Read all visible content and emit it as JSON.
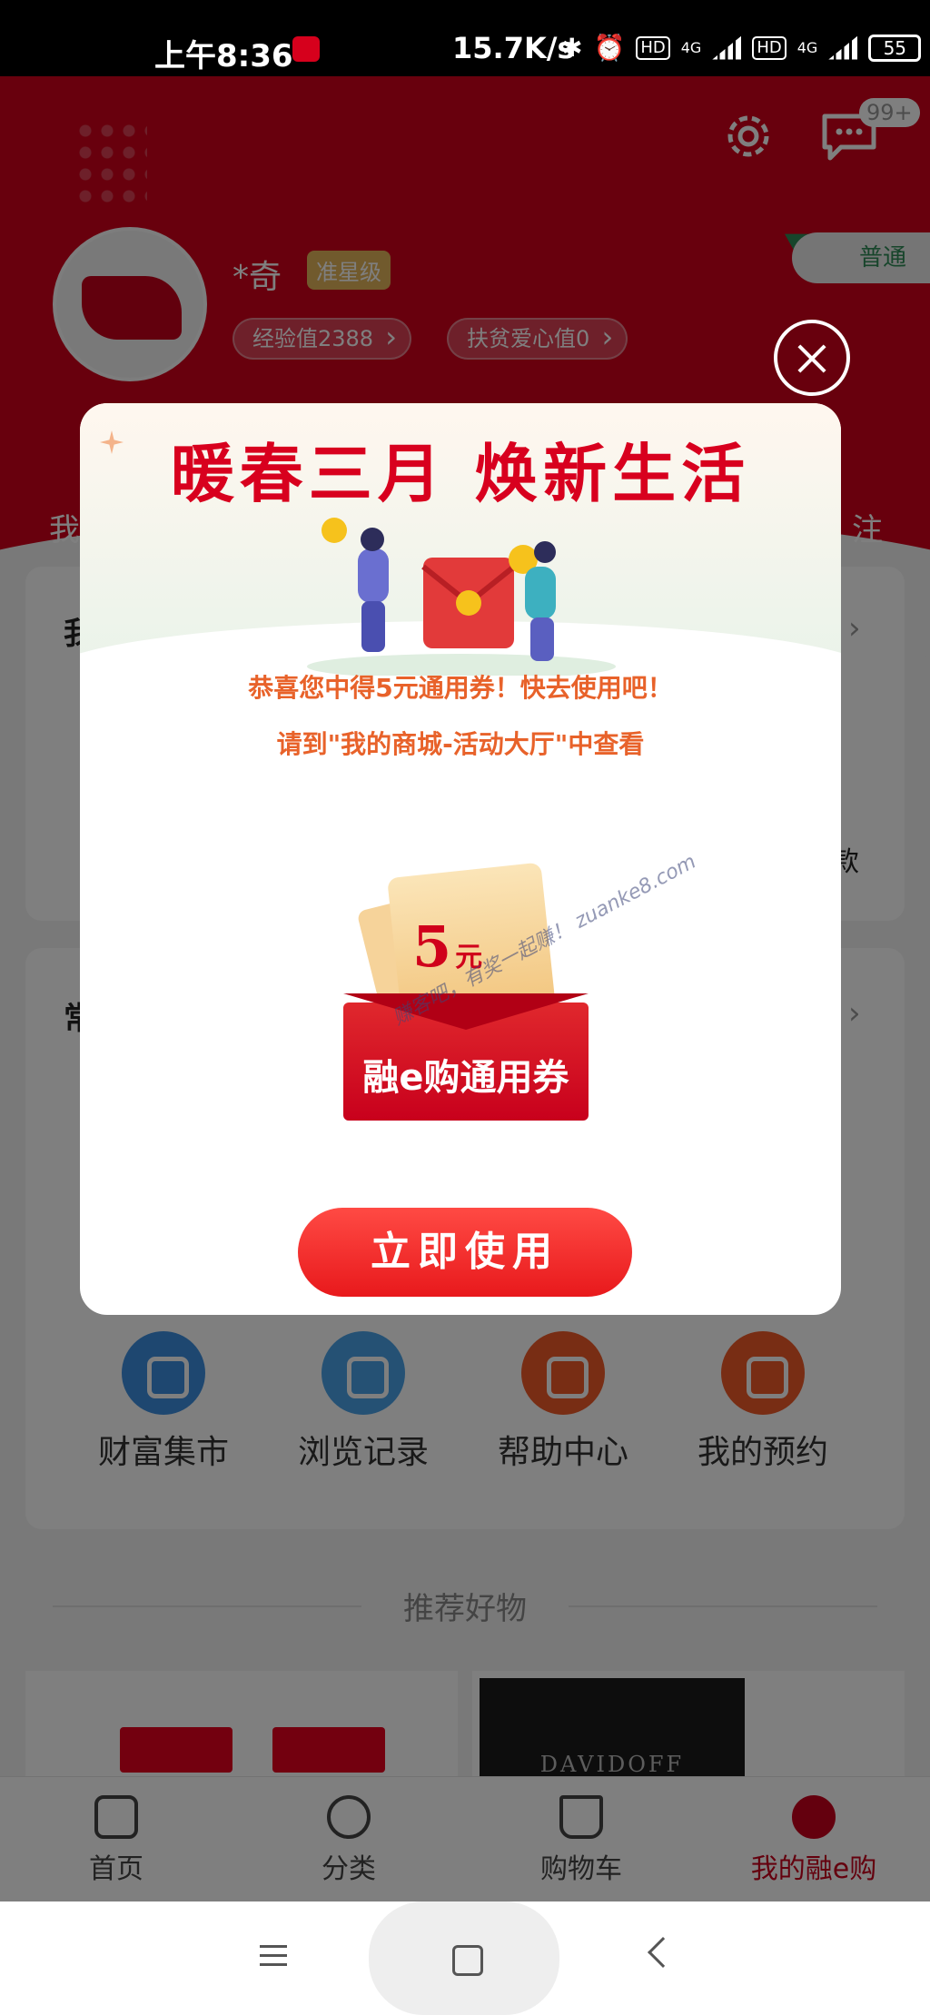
{
  "status_bar": {
    "time": "上午8:36",
    "speed": "15.7K/s",
    "hd1": "HD",
    "hd2": "HD",
    "net1": "4G",
    "net2": "4G",
    "battery": "55"
  },
  "header": {
    "username": "*奇",
    "level": "准星级",
    "experience": "经验值2388",
    "charity": "扶贫爱心值0",
    "message_badge": "99+",
    "membership": "普通"
  },
  "popup": {
    "title": "暖春三月 焕新生活",
    "congrats": "恭喜您中得5元通用券！快去使用吧！",
    "hint": "请到\"我的商城-活动大厅\"中查看",
    "coupon_amount": "5",
    "coupon_unit": "元",
    "coupon_name": "融e购通用券",
    "watermark": "赚客吧，有奖一起赚！ zuanke8.com",
    "use_button": "立即使用"
  },
  "behind": {
    "left_tab": "我",
    "right_tab": "注",
    "card1_char": "我",
    "card1_right": "款",
    "card2_char": "常"
  },
  "quick_actions": [
    {
      "label": "财富集市",
      "color": "#3d8fe0",
      "icon": "market-icon"
    },
    {
      "label": "浏览记录",
      "color": "#4aa3e8",
      "icon": "history-icon"
    },
    {
      "label": "帮助中心",
      "color": "#f05a28",
      "icon": "headset-icon"
    },
    {
      "label": "我的预约",
      "color": "#f05a28",
      "icon": "calendar-icon"
    }
  ],
  "recommend_title": "推荐好物",
  "product_brand": "DAVIDOFF",
  "bottom_nav": [
    {
      "label": "首页",
      "icon": "home-icon"
    },
    {
      "label": "分类",
      "icon": "category-icon"
    },
    {
      "label": "购物车",
      "icon": "cart-icon"
    },
    {
      "label": "我的融e购",
      "icon": "profile-icon",
      "active": true
    }
  ],
  "colors": {
    "brand_red": "#d0011b",
    "accent_orange": "#e8622a",
    "active_nav": "#c8001c"
  }
}
